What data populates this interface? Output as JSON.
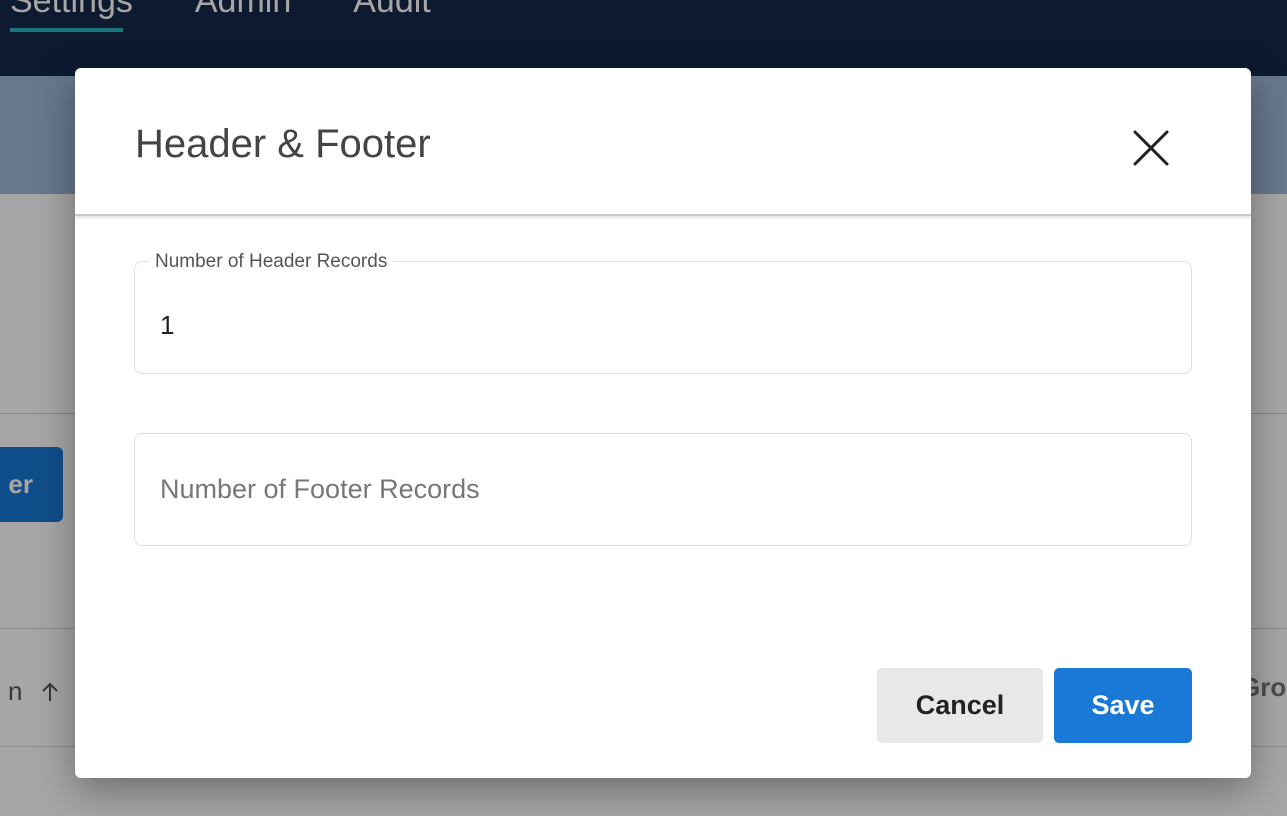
{
  "nav": {
    "tabs": [
      {
        "label": "Settings"
      },
      {
        "label": "Admin"
      },
      {
        "label": "Audit"
      }
    ]
  },
  "background": {
    "button_label_partial": "er",
    "col_left_partial": "n",
    "col_left_sort_icon": "arrow-up-icon",
    "col_right_partial": "Gro"
  },
  "modal": {
    "title": "Header & Footer",
    "close_icon": "close-icon",
    "header_records": {
      "label": "Number of Header Records",
      "value": "1"
    },
    "footer_records": {
      "placeholder": "Number of Footer Records",
      "value": ""
    },
    "cancel_label": "Cancel",
    "save_label": "Save"
  },
  "colors": {
    "nav_bg": "#15294a",
    "nav_active_underline": "#2bb3c0",
    "primary_button": "#1a78d6",
    "cancel_button": "#e8e8e8"
  }
}
